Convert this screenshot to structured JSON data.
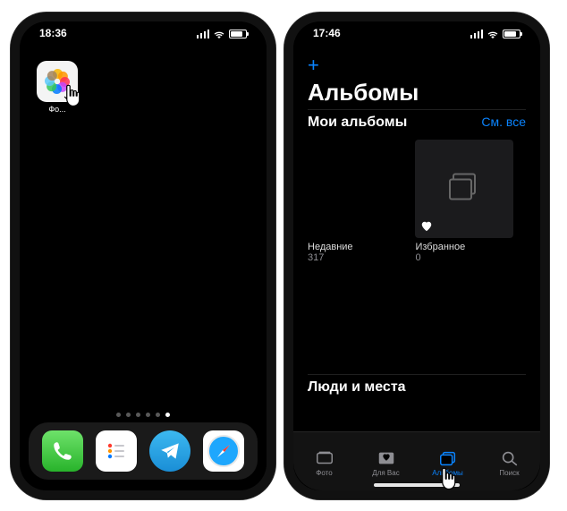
{
  "phone1": {
    "status_time": "18:36",
    "app": {
      "label": "Фо...",
      "semantic": "photos-app"
    },
    "page_dots": {
      "count": 6,
      "active_index": 5
    }
  },
  "phone2": {
    "status_time": "17:46",
    "nav_plus": "+",
    "title": "Альбомы",
    "section_my": "Мои альбомы",
    "see_all": "См. все",
    "albums": [
      {
        "title": "Недавние",
        "count": "317"
      },
      {
        "title": "Избранное",
        "count": "0"
      }
    ],
    "section_people": "Люди и места",
    "tabs": [
      {
        "label": "Фото",
        "icon": "photo-stack-icon"
      },
      {
        "label": "Для Вас",
        "icon": "for-you-icon"
      },
      {
        "label": "Альбомы",
        "icon": "albums-icon"
      },
      {
        "label": "Поиск",
        "icon": "search-icon"
      }
    ],
    "active_tab_index": 2
  },
  "colors": {
    "accent": "#0a84ff",
    "muted": "#8e8e93"
  }
}
